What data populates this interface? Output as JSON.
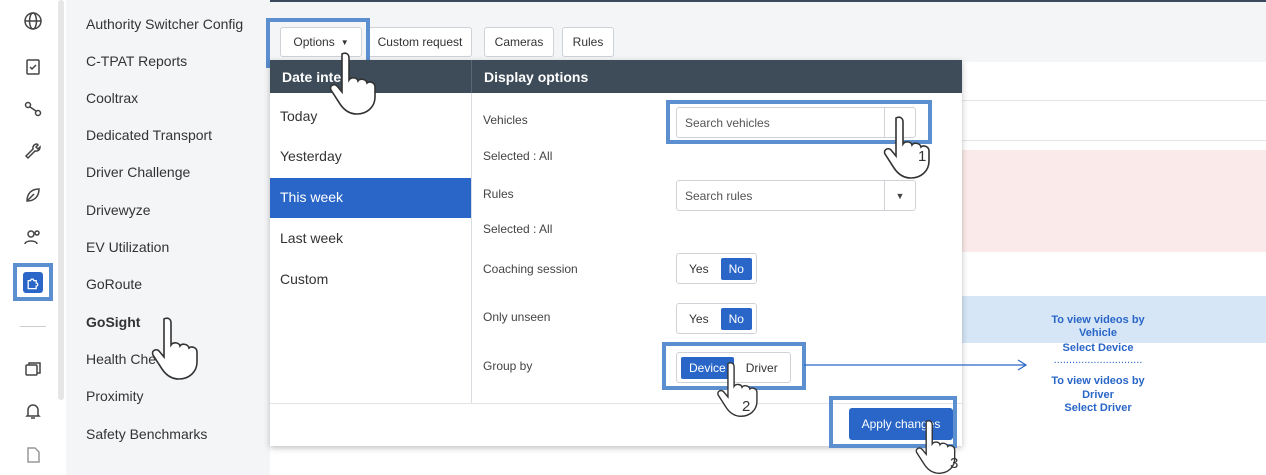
{
  "menu": {
    "items": [
      {
        "label": "Authority Switcher Config"
      },
      {
        "label": "C-TPAT Reports"
      },
      {
        "label": "Cooltrax"
      },
      {
        "label": "Dedicated Transport"
      },
      {
        "label": "Driver Challenge"
      },
      {
        "label": "Drivewyze"
      },
      {
        "label": "EV Utilization"
      },
      {
        "label": "GoRoute"
      },
      {
        "label": "GoSight"
      },
      {
        "label": "Health Che"
      },
      {
        "label": "Proximity"
      },
      {
        "label": "Safety Benchmarks"
      }
    ]
  },
  "toolbar": {
    "options_label": "Options",
    "custom_request_label": "Custom request",
    "cameras_label": "Cameras",
    "rules_label": "Rules"
  },
  "panel": {
    "date_header": "Date inte",
    "display_header": "Display options",
    "date_items": [
      "Today",
      "Yesterday",
      "This week",
      "Last week",
      "Custom"
    ],
    "vehicles_label": "Vehicles",
    "vehicles_placeholder": "Search vehicles",
    "vehicles_selected": "Selected : All",
    "rules_label": "Rules",
    "rules_placeholder": "Search rules",
    "rules_selected": "Selected : All",
    "coaching_label": "Coaching session",
    "unseen_label": "Only unseen",
    "yes": "Yes",
    "no": "No",
    "group_by_label": "Group by",
    "device": "Device",
    "driver": "Driver",
    "apply_label": "Apply changes"
  },
  "annotation": {
    "line1": "To view videos by",
    "line2": "Vehicle",
    "line3": "Select Device",
    "dots": ".............................",
    "line4": "To view videos by",
    "line5": "Driver",
    "line6": "Select Driver",
    "step1": "1",
    "step2": "2",
    "step3": "3"
  },
  "colors": {
    "accent": "#2a66c8",
    "highlight": "#5b8fd0",
    "header": "#3e4c59"
  }
}
